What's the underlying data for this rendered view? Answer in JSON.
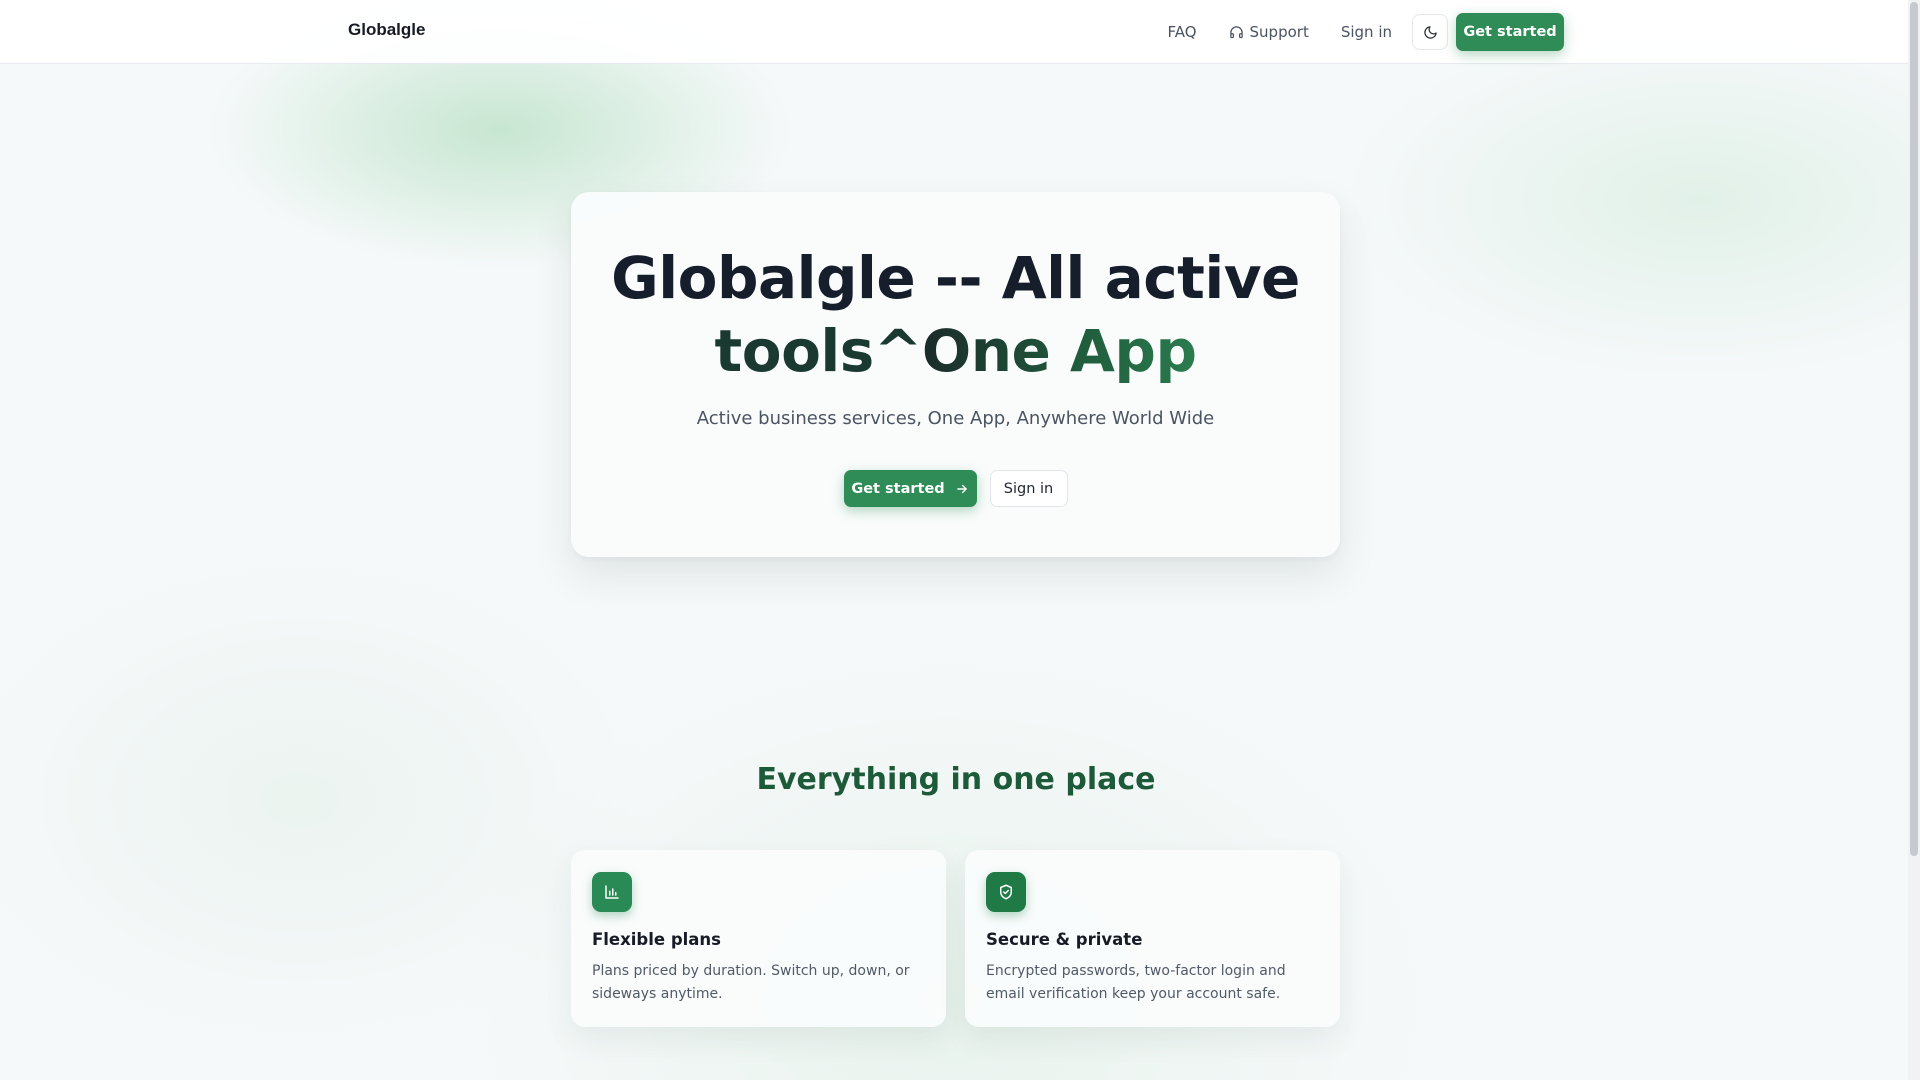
{
  "nav": {
    "brand": "Globalgle",
    "links": {
      "faq": "FAQ",
      "support": "Support",
      "signin": "Sign in"
    },
    "cta": "Get started",
    "icons": {
      "support": "headset-icon",
      "theme": "moon-icon"
    }
  },
  "hero": {
    "title_line1": "Globalgle -- All active",
    "title_line2_a": "tools^",
    "title_line2_b": "One App",
    "subtitle": "Active business services, One App, Anywhere World Wide",
    "primary_cta": "Get started",
    "secondary_cta": "Sign in",
    "icons": {
      "primary_cta": "arrow-right-icon"
    }
  },
  "features": {
    "title": "Everything in one place",
    "items": [
      {
        "icon": "bar-chart-icon",
        "title": "Flexible plans",
        "description": "Plans priced by duration. Switch up, down, or sideways anytime."
      },
      {
        "icon": "shield-check-icon",
        "title": "Secure & private",
        "description": "Encrypted passwords, two-factor login and email verification keep your account safe."
      }
    ]
  },
  "colors": {
    "accent": "#2f8c57",
    "heading_green": "#1d5a39",
    "text_dark": "#161d2b"
  }
}
